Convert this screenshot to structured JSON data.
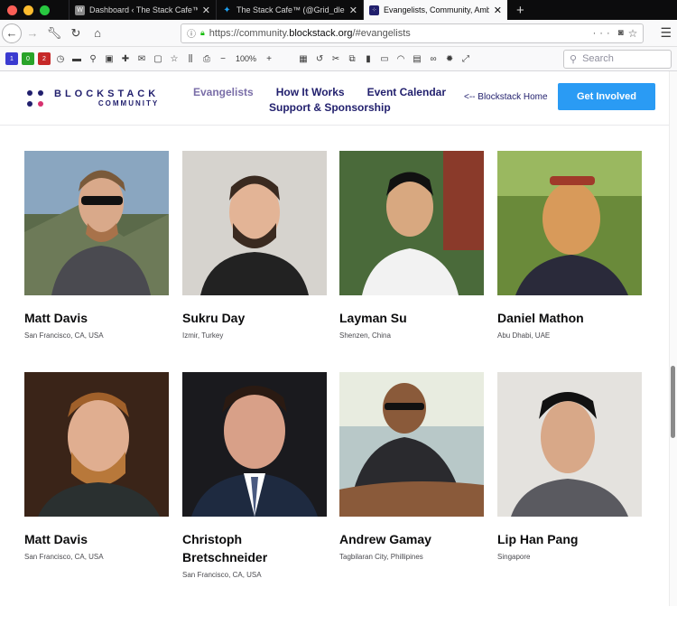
{
  "browser": {
    "tabs": [
      {
        "title": "Dashboard ‹ The Stack Cafe™ —",
        "fav_color": "#8a8a8a"
      },
      {
        "title": "The Stack Cafe™ (@Grid_dles)",
        "fav_color": "#1da1f2"
      },
      {
        "title": "Evangelists, Community, Ambas",
        "fav_color": "#211f6d"
      }
    ],
    "url_prefix": "https://community.",
    "url_domain": "blockstack.org",
    "url_suffix": "/#evangelists",
    "zoom": "100%",
    "search_placeholder": "Search"
  },
  "site": {
    "logo_line1": "BLOCKSTACK",
    "logo_line2": "COMMUNITY",
    "menu": {
      "evangelists": "Evangelists",
      "how_it_works": "How It Works",
      "event_calendar": "Event Calendar",
      "support": "Support & Sponsorship"
    },
    "home_link": "<-- Blockstack Home",
    "cta": "Get Involved"
  },
  "evangelists": [
    {
      "name": "Matt Davis",
      "location": "San Francisco, CA, USA"
    },
    {
      "name": "Sukru Day",
      "location": "Izmir, Turkey"
    },
    {
      "name": "Layman Su",
      "location": "Shenzen, China"
    },
    {
      "name": "Daniel Mathon",
      "location": "Abu Dhabi, UAE"
    },
    {
      "name": "Matt Davis",
      "location": "San Francisco, CA, USA"
    },
    {
      "name": "Christoph Bretschneider",
      "location": "San Francisco, CA, USA"
    },
    {
      "name": "Andrew Gamay",
      "location": "Tagbilaran City, Phillipines"
    },
    {
      "name": "Lip Han Pang",
      "location": "Singapore"
    }
  ],
  "colors": {
    "brand": "#211f6d",
    "accent": "#2a9bf4",
    "active_menu": "#7a6ea8"
  }
}
